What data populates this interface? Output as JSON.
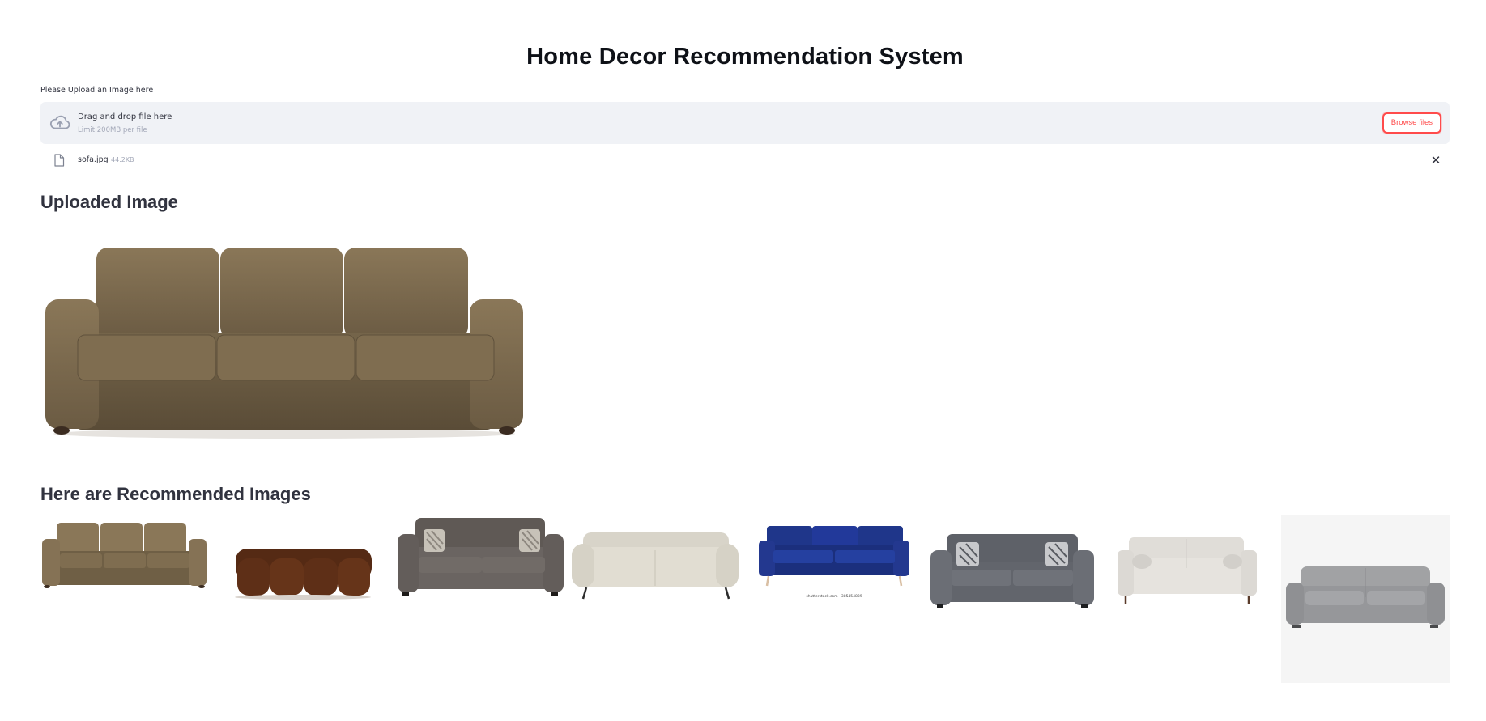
{
  "app": {
    "title": "Home Decor Recommendation System"
  },
  "uploader": {
    "label": "Please Upload an Image here",
    "dropzone_text": "Drag and drop file here",
    "limit_text": "Limit 200MB per file",
    "browse_label": "Browse files",
    "upload_icon": "cloud-upload-icon"
  },
  "uploaded_file": {
    "name": "sofa.jpg",
    "size": "44.2KB",
    "file_icon": "file-icon",
    "remove_icon": "close-icon",
    "remove_label": "✕"
  },
  "sections": {
    "uploaded_heading": "Uploaded Image",
    "recommended_heading": "Here are Recommended Images"
  },
  "recommendations": [
    {
      "kind": "three-seater",
      "color": "#7b6a4f"
    },
    {
      "kind": "tufted",
      "color": "#5a2e17"
    },
    {
      "kind": "pillowed",
      "color": "#6a6461"
    },
    {
      "kind": "minimal",
      "color": "#dcd8cc"
    },
    {
      "kind": "blue",
      "color": "#20378c",
      "caption": "shutterstock.com · 385454839"
    },
    {
      "kind": "pillowed",
      "color": "#676a71"
    },
    {
      "kind": "light",
      "color": "#e3e0dc"
    },
    {
      "kind": "grey-on-bg",
      "color": "#9b9c9e"
    }
  ],
  "colors": {
    "accent": "#ff4b4b",
    "dropzone_bg": "#f0f2f6",
    "text": "#31333f"
  }
}
